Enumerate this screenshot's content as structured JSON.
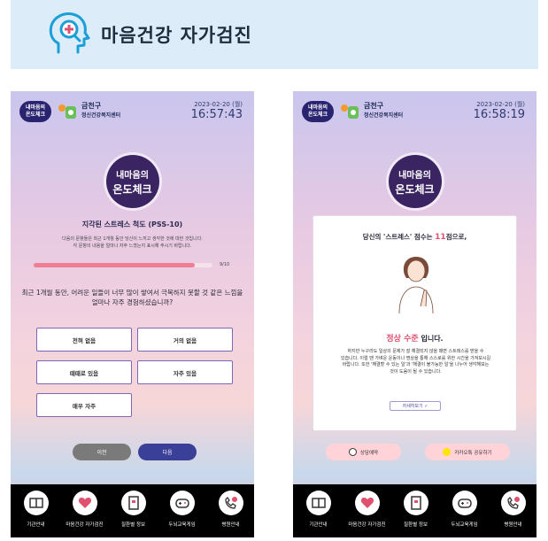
{
  "banner": {
    "title": "마음건강 자가검진"
  },
  "left": {
    "header": {
      "logo_text1": "내마음의",
      "logo_text2": "온도체크",
      "center_name": "금천구",
      "center_sub": "정신건강복지센터",
      "date": "2023-02-20 (월)",
      "time": "16:57:43"
    },
    "mark": {
      "line1": "내마음의",
      "line2": "온도체크"
    },
    "title": "지각된 스트레스 척도 (PSS-10)",
    "desc1": "다음의 문항들은 최근 1개월 동안 당신이 느끼고 생각한 것에 대한 것입니다.",
    "desc2": "각 문항의 내용을 얼마나 자주 느꼈는지 표시해 주시기 바랍니다.",
    "progress": {
      "value": 0.9,
      "label": "9/10"
    },
    "question1": "최근 1개월 동안, 어려운 일들이 너무 많이 쌓여서 극복하지 못할 것 같은 느낌을",
    "question2": "얼마나 자주 경험하셨습니까?",
    "options": [
      "전혀 없음",
      "거의 없음",
      "때때로 있음",
      "자주 있음",
      "매우 자주"
    ],
    "prev": "이전",
    "next": "다음"
  },
  "right": {
    "header": {
      "logo_text1": "내마음의",
      "logo_text2": "온도체크",
      "center_name": "금천구",
      "center_sub": "정신건강복지센터",
      "date": "2023-02-20 (월)",
      "time": "16:58:19"
    },
    "mark": {
      "line1": "내마음의",
      "line2": "온도체크"
    },
    "score_prefix": "당신의 '스트레스' 점수는",
    "score": "11",
    "score_suffix": "점으로,",
    "level": "정상 수준",
    "level_suffix": "입니다.",
    "desc1": "하지만 누구라도 일상의 문제가 잘 해결되지 않을 때면 스트레스를 받을 수",
    "desc2": "있습니다. 이럴 땐 가벼운 운동이나 명상을 통해 스스로를 위한 시간을 가져보시길",
    "desc3": "바랍니다. 또한 '해결할 수 있는 일'과 '해결이 불가능한 일'을 나누어 생각해보는",
    "desc4": "것이 도움이 될 수 있습니다.",
    "more": "자세히보기 ✓",
    "counsel": "상담예약",
    "share": "카카오톡 공유하기"
  },
  "tabs": [
    "기관안내",
    "마음건강 자가검진",
    "질환별 정보",
    "두뇌교육게임",
    "병원안내"
  ],
  "colors": {
    "accent": "#e0506f",
    "primary": "#3a3f98",
    "banner": "#dcecf8"
  }
}
